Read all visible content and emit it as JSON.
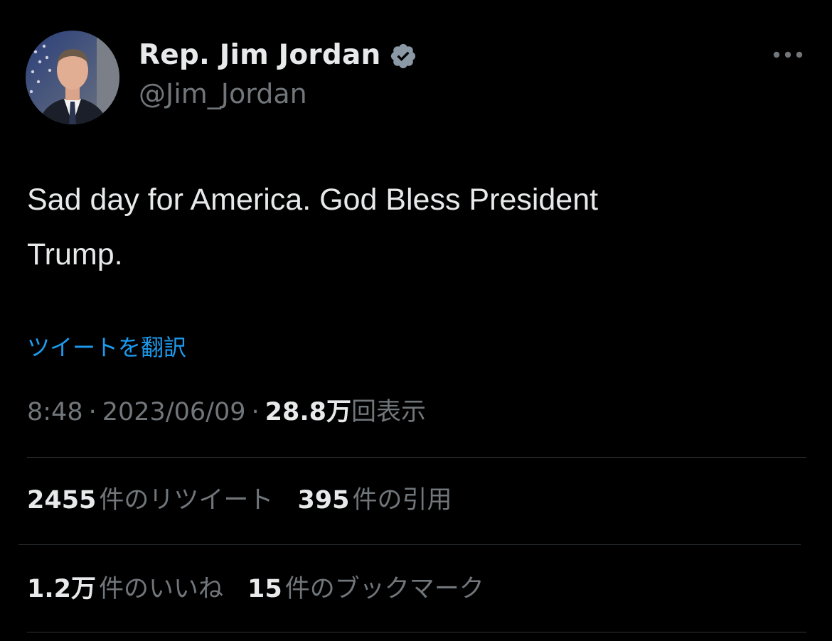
{
  "author": {
    "display_name": "Rep. Jim Jordan",
    "handle": "@Jim_Jordan",
    "verified_icon": "verified-badge-icon",
    "verified_color": "#8b98a5"
  },
  "more_icon": "more-horizontal-icon",
  "tweet": {
    "line1": "Sad day for America. God Bless President",
    "line2": "Trump."
  },
  "translate_label": "ツイートを翻訳",
  "meta": {
    "time": "8:48",
    "separator": "·",
    "date": "2023/06/09",
    "views_count": "28.8万",
    "views_label": "回表示"
  },
  "stats": {
    "retweets": {
      "count": "2455",
      "label": "件のリツイート"
    },
    "quotes": {
      "count": "395",
      "label": "件の引用"
    },
    "likes": {
      "count": "1.2万",
      "label": "件のいいね"
    },
    "bookmarks": {
      "count": "15",
      "label": "件のブックマーク"
    }
  },
  "colors": {
    "background": "#000000",
    "primary_text": "#e7e9ea",
    "secondary_text": "#71767b",
    "link": "#1d9bf0",
    "divider": "#2f3336"
  }
}
